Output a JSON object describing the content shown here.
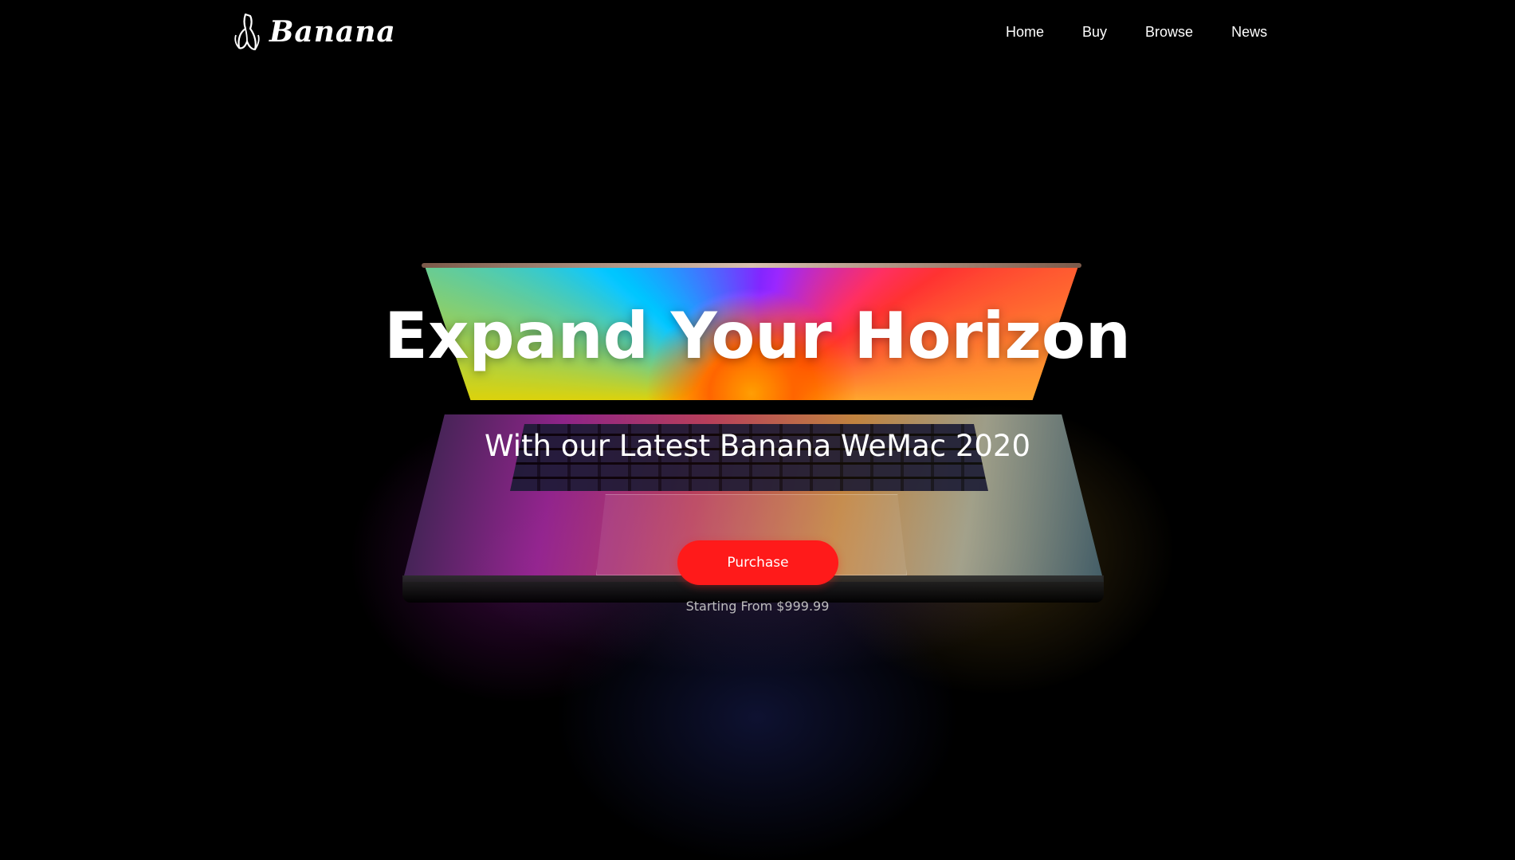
{
  "brand": {
    "name": "Banana",
    "logo_icon": "banana-icon"
  },
  "nav": {
    "items": [
      {
        "label": "Home"
      },
      {
        "label": "Buy"
      },
      {
        "label": "Browse"
      },
      {
        "label": "News"
      }
    ]
  },
  "hero": {
    "headline": "Expand Your Horizon",
    "subheadline": "With our Latest Banana WeMac 2020",
    "cta_label": "Purchase",
    "price_note": "Starting From $999.99"
  },
  "colors": {
    "background": "#000000",
    "accent": "#ff1a1a",
    "text": "#ffffff",
    "muted_text": "#bdbdbd"
  }
}
